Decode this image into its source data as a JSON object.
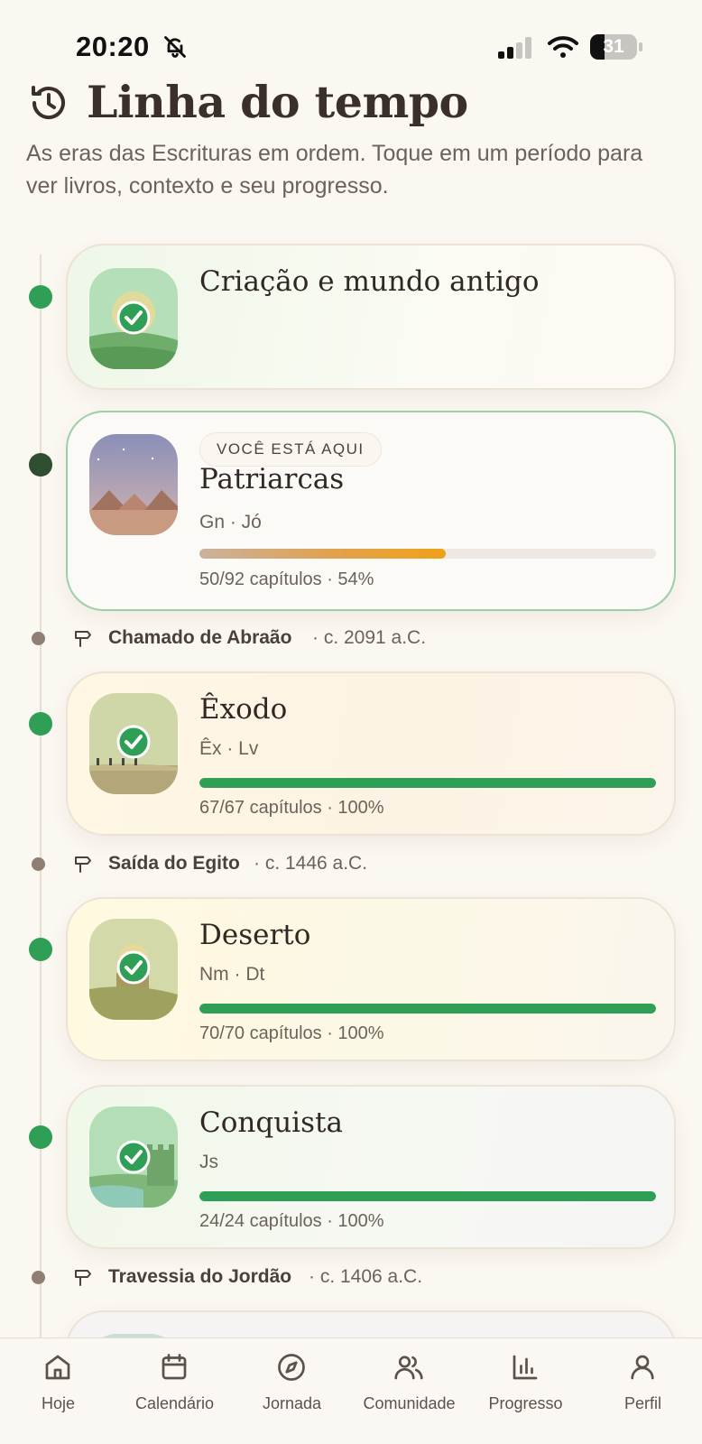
{
  "status": {
    "time": "20:20",
    "battery": "31"
  },
  "header": {
    "title": "Linha do tempo",
    "subtitle": "As eras das Escrituras em ordem. Toque em um período para ver livros, contexto e seu progresso."
  },
  "periods": [
    {
      "title": "Criação e mundo antigo",
      "books": "",
      "progress_text": "",
      "progress": 1.0,
      "completed": true
    },
    {
      "title": "Patriarcas",
      "badge": "VOCÊ ESTÁ AQUI",
      "books": "Gn · Jó",
      "progress_text": "50/92 capítulos · 54%",
      "progress": 0.54,
      "completed": false
    },
    {
      "title": "Êxodo",
      "books": "Êx · Lv",
      "progress_text": "67/67 capítulos · 100%",
      "progress": 1.0,
      "completed": true
    },
    {
      "title": "Deserto",
      "books": "Nm · Dt",
      "progress_text": "70/70 capítulos · 100%",
      "progress": 1.0,
      "completed": true
    },
    {
      "title": "Conquista",
      "books": "Js",
      "progress_text": "24/24 capítulos · 100%",
      "progress": 1.0,
      "completed": true
    }
  ],
  "milestones": [
    {
      "name": "Chamado de Abraão",
      "date": "· c. 2091 a.C."
    },
    {
      "name": "Saída do Egito",
      "date": "· c. 1446 a.C."
    },
    {
      "name": "Travessia do Jordão",
      "date": "· c. 1406 a.C."
    }
  ],
  "nav": [
    {
      "label": "Hoje",
      "icon": "home-icon"
    },
    {
      "label": "Calendário",
      "icon": "calendar-icon"
    },
    {
      "label": "Jornada",
      "icon": "compass-icon"
    },
    {
      "label": "Comunidade",
      "icon": "users-icon"
    },
    {
      "label": "Progresso",
      "icon": "bar-chart-icon"
    },
    {
      "label": "Perfil",
      "icon": "user-icon"
    }
  ],
  "colors": {
    "done": "#2f9f56",
    "current": "#2e4d31",
    "accent": "#f0a11a",
    "background": "#fbf7f1"
  }
}
